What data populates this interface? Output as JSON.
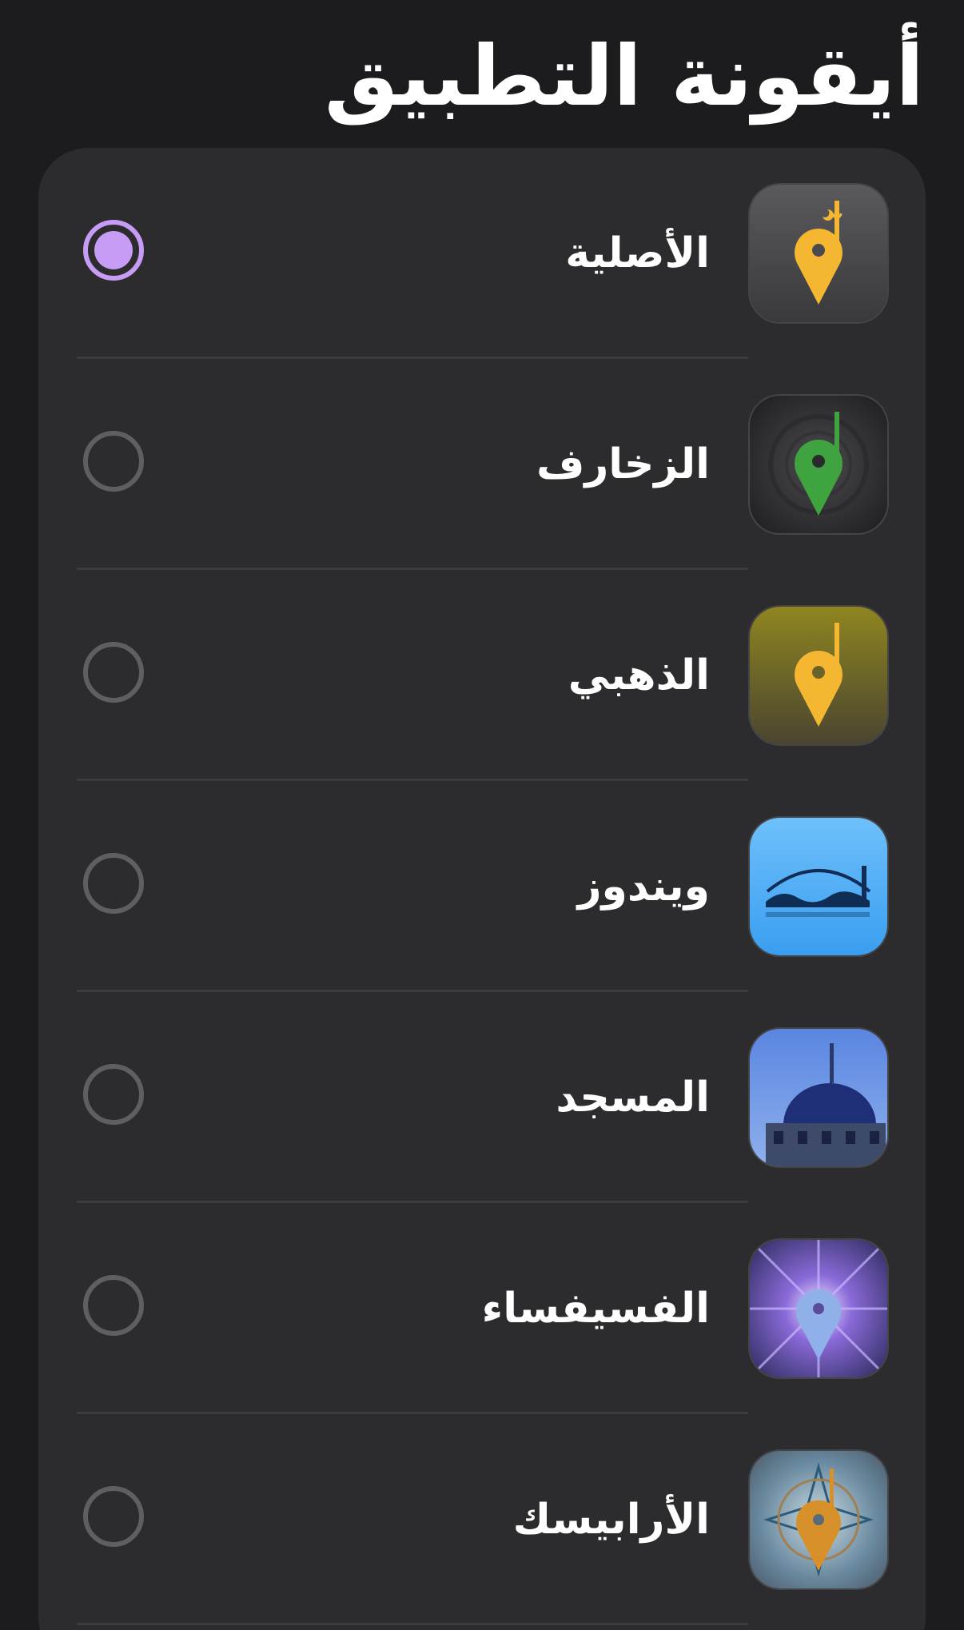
{
  "page": {
    "title": "أيقونة التطبيق"
  },
  "colors": {
    "background": "#1c1c1e",
    "card": "#2c2c2e",
    "accent": "#c69cf5",
    "radio_unselected": "#5f5f63",
    "divider": "#3d3d40"
  },
  "icons_list": {
    "items": [
      {
        "label": "الأصلية",
        "icon": "gold-pin-dark-icon",
        "selected": true
      },
      {
        "label": "الزخارف",
        "icon": "green-pin-ornament-icon",
        "selected": false
      },
      {
        "label": "الذهبي",
        "icon": "gold-pin-olive-icon",
        "selected": false
      },
      {
        "label": "ويندوز",
        "icon": "calligraphy-blue-icon",
        "selected": false
      },
      {
        "label": "المسجد",
        "icon": "mosque-dome-icon",
        "selected": false
      },
      {
        "label": "الفسيفساء",
        "icon": "mosaic-pin-icon",
        "selected": false
      },
      {
        "label": "الأرابيسك",
        "icon": "arabesque-pin-icon",
        "selected": false
      }
    ]
  }
}
